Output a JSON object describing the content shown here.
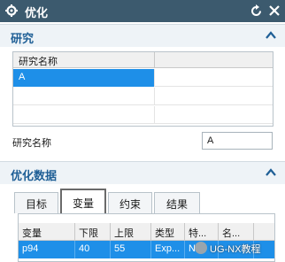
{
  "window": {
    "title": "优化"
  },
  "study": {
    "section_title": "研究",
    "table_header": "研究名称",
    "rows": [
      "A",
      "",
      "",
      ""
    ],
    "name_label": "研究名称",
    "name_value": "A"
  },
  "opt_data": {
    "section_title": "优化数据",
    "tabs": [
      "目标",
      "变量",
      "约束",
      "结果"
    ],
    "active_tab": "变量",
    "columns": [
      "变量",
      "下限",
      "上限",
      "类型",
      "特...",
      "名..."
    ],
    "rows": [
      [
        "p94",
        "40",
        "55",
        "Exp...",
        "NA",
        ""
      ]
    ]
  },
  "watermark": "UG-NX教程",
  "colors": {
    "titlebar": "#3c5a6e",
    "section_title": "#1f5f96",
    "selection": "#1e8fe8"
  }
}
